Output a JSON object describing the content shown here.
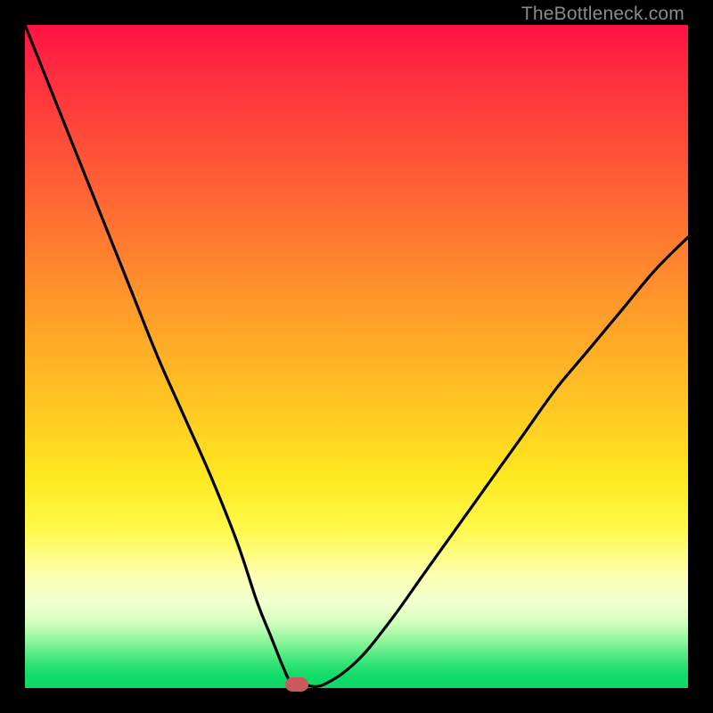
{
  "watermark": "TheBottleneck.com",
  "chart_data": {
    "type": "line",
    "title": "",
    "xlabel": "",
    "ylabel": "",
    "xlim": [
      0,
      100
    ],
    "ylim": [
      0,
      100
    ],
    "grid": false,
    "legend": false,
    "series": [
      {
        "name": "bottleneck-curve",
        "x": [
          0,
          4,
          8,
          12,
          16,
          20,
          24,
          28,
          32,
          35,
          37,
          39,
          40,
          41,
          42,
          45,
          50,
          55,
          60,
          65,
          70,
          75,
          80,
          85,
          90,
          95,
          100
        ],
        "y": [
          100,
          90,
          80,
          70,
          60,
          50,
          41,
          32,
          22,
          13,
          8,
          3,
          1,
          0.5,
          0.5,
          0.5,
          4,
          10,
          17,
          24,
          31,
          38,
          45,
          51,
          57,
          63,
          68
        ]
      }
    ],
    "marker": {
      "x": 41,
      "y": 0.5
    },
    "background_gradient": {
      "top": "#ff1244",
      "mid": "#ffe81f",
      "bottom": "#0fd768"
    }
  }
}
